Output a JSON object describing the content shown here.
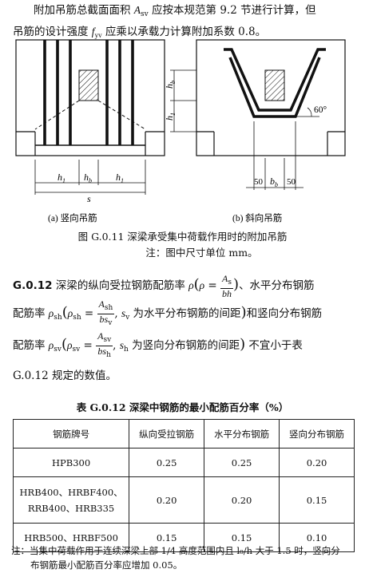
{
  "intro": {
    "line1a": "附加吊筋总截面面积 ",
    "A": "A",
    "sv": "sv",
    "line1b": " 应按本规范第 9.2 节进行计算，但",
    "line2a": "吊筋的设计强度 ",
    "f": "f",
    "yv": "yv",
    "line2b": " 应乘以承载力计算附加系数 0.8。"
  },
  "figure": {
    "left_caption": "(a)  竖向吊筋",
    "right_caption": "(b)  斜向吊筋",
    "labels": {
      "hb": "h",
      "hb_sub": "b",
      "h1": "h",
      "h1_sub": "1",
      "s": "s",
      "angle": "60°",
      "dim50a": "50",
      "dim50b": "50",
      "b": "b",
      "b_sub": "b"
    },
    "title": "图 G.0.11    深梁承受集中荷载作用时的附加吊筋",
    "note": "注：图中尺寸单位 mm。"
  },
  "clause": {
    "num": "G.0.12",
    "t1": "   深梁的纵向受拉钢筋配筋率 ",
    "t2": "、水平分布钢筋",
    "t3": "配筋率 ",
    "t4": " 为水平分布钢筋的间距",
    "t5": "和竖向分布钢筋",
    "t6": "配筋率 ",
    "t7": " 为竖向分布钢筋的间距",
    "t8": " 不宜小于表",
    "t9": "G.0.12 规定的数值。",
    "rho": "ρ",
    "As": "A",
    "s_sub": "s",
    "bh": "bh",
    "sh": "sh",
    "sv": "sv",
    "bsv": "bs",
    "v": "v",
    "h": "h",
    "sv_var": "s",
    "sh_var": "s",
    "eq": " = "
  },
  "table": {
    "title": "表 G.0.12    深梁中钢筋的最小配筋百分率（%）",
    "headers": [
      "钢筋牌号",
      "纵向受拉钢筋",
      "水平分布钢筋",
      "竖向分布钢筋"
    ],
    "rows": [
      {
        "grade": [
          "HPB300"
        ],
        "values": [
          "0.25",
          "0.25",
          "0.20"
        ]
      },
      {
        "grade": [
          "HRB400、HRBF400、",
          "RRB400、HRB335"
        ],
        "values": [
          "0.20",
          "0.20",
          "0.15"
        ]
      },
      {
        "grade": [
          "HRB500、HRBF500"
        ],
        "values": [
          "0.15",
          "0.15",
          "0.10"
        ]
      }
    ]
  },
  "note": {
    "line1": "注：当集中荷载作用于连续深梁上部 1/4 高度范围内且 l₀/h 大于 1.5 时，竖向分",
    "line2": "布钢筋最小配筋百分率应增加 0.05。"
  }
}
